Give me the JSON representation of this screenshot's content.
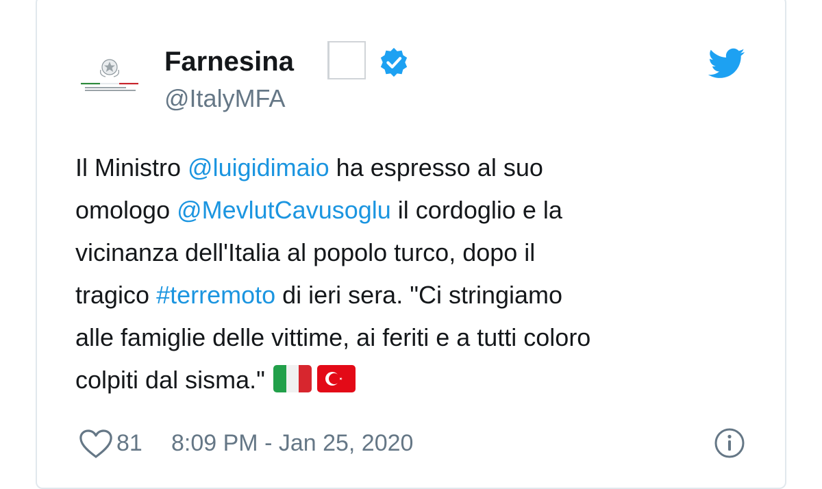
{
  "author": {
    "display_name": "Farnesina",
    "handle": "@ItalyMFA",
    "avatar_icon": "italy-emblem-logo",
    "avatar_caption": "Ministero degli Affari Esteri e della Cooperazione Internazionale",
    "verified_icon": "verified-badge-icon"
  },
  "platform_icon": "twitter-bird-icon",
  "tweet": {
    "lines": [
      [
        {
          "text": "Il Ministro ",
          "link": false
        },
        {
          "text": "@luigidimaio",
          "link": true
        },
        {
          "text": " ha espresso al suo",
          "link": false
        }
      ],
      [
        {
          "text": "omologo ",
          "link": false
        },
        {
          "text": "@MevlutCavusoglu",
          "link": true
        },
        {
          "text": " il cordoglio e la",
          "link": false
        }
      ],
      [
        {
          "text": "vicinanza dell'Italia al popolo turco, dopo il",
          "link": false
        }
      ],
      [
        {
          "text": "tragico ",
          "link": false
        },
        {
          "text": "#terremoto",
          "link": true
        },
        {
          "text": " di ieri sera. \"Ci stringiamo",
          "link": false
        }
      ],
      [
        {
          "text": "alle famiglie delle vittime, ai feriti e a tutti coloro",
          "link": false
        }
      ],
      [
        {
          "text": "colpiti dal sisma.\"",
          "link": false
        }
      ]
    ],
    "emojis": [
      "italy-flag-emoji",
      "turkey-flag-emoji"
    ]
  },
  "footer": {
    "likes": "81",
    "timestamp": "8:09 PM - Jan 25, 2020",
    "like_icon": "heart-icon",
    "info_icon": "info-icon"
  },
  "colors": {
    "link": "#1b95e0",
    "secondary_text": "#657786",
    "verified": "#1da1f2",
    "twitter_blue": "#1da1f2",
    "border": "#e1e8ed"
  }
}
